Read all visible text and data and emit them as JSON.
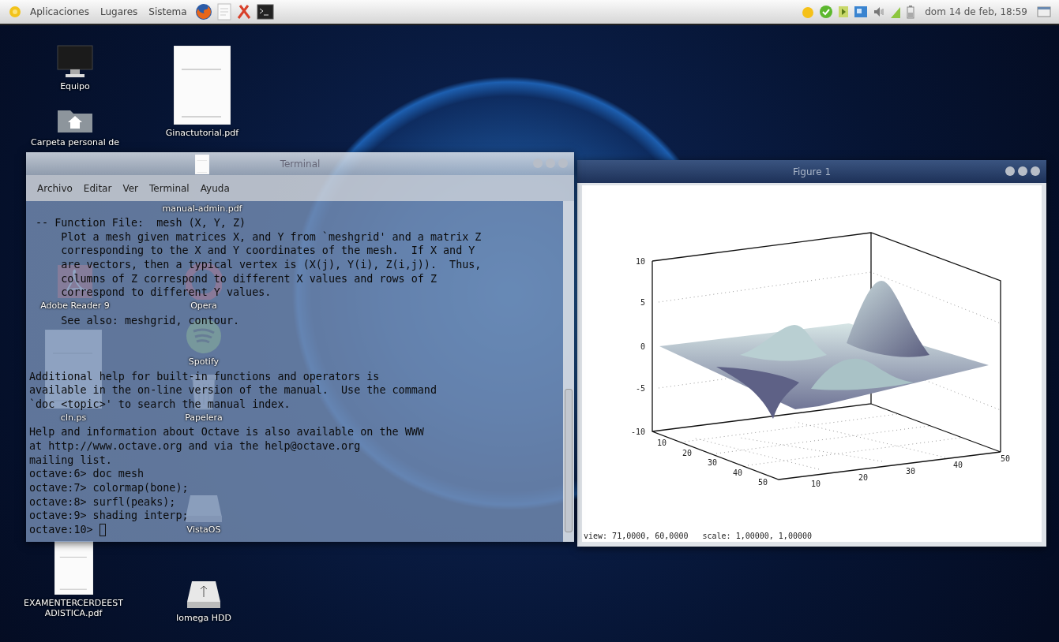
{
  "top_panel": {
    "menus": [
      "Aplicaciones",
      "Lugares",
      "Sistema"
    ],
    "clock": "dom 14 de feb, 18:59"
  },
  "desktop_icons": [
    {
      "label": "Equipo",
      "kind": "monitor"
    },
    {
      "label": "Carpeta personal de",
      "kind": "home"
    },
    {
      "label": "Adobe Reader 9",
      "kind": "reader"
    },
    {
      "label": "cln.ps",
      "kind": "document"
    },
    {
      "label": "EXAMENTERCERDEESTADISTICA.pdf",
      "kind": "document"
    },
    {
      "label": "Ginactutorial.pdf",
      "kind": "document"
    },
    {
      "label": "manual-admin.pdf",
      "kind": "document"
    },
    {
      "label": "Opera",
      "kind": "opera"
    },
    {
      "label": "Spotify",
      "kind": "spotify"
    },
    {
      "label": "Papelera",
      "kind": "trash"
    },
    {
      "label": "VistaOS",
      "kind": "drive"
    },
    {
      "label": "Iomega HDD",
      "kind": "usb"
    }
  ],
  "terminal": {
    "title": "Terminal",
    "menu": [
      "Archivo",
      "Editar",
      "Ver",
      "Terminal",
      "Ayuda"
    ],
    "blocks": [
      [
        " -- Function File:  mesh (X, Y, Z)",
        "     Plot a mesh given matrices X, and Y from `meshgrid' and a matrix Z",
        "     corresponding to the X and Y coordinates of the mesh.  If X and Y",
        "     are vectors, then a typical vertex is (X(j), Y(i), Z(i,j)).  Thus,",
        "     columns of Z correspond to different X values and rows of Z",
        "     correspond to different Y values."
      ],
      [
        "     See also: meshgrid, contour."
      ],
      [
        "Additional help for built-in functions and operators is",
        "available in the on-line version of the manual.  Use the command",
        "`doc <topic>' to search the manual index."
      ],
      [
        "Help and information about Octave is also available on the WWW",
        "at http://www.octave.org and via the help@octave.org",
        "mailing list.",
        "octave:6> doc mesh",
        "octave:7> colormap(bone);",
        "octave:8> surfl(peaks);",
        "octave:9> shading interp;",
        "octave:10> "
      ]
    ]
  },
  "figure": {
    "title": "Figure 1",
    "z_ticks": [
      "10",
      "5",
      "0",
      "-5",
      "-10"
    ],
    "left_ticks": [
      "10",
      "20",
      "30",
      "40",
      "50"
    ],
    "right_ticks": [
      "10",
      "20",
      "30",
      "40",
      "50"
    ],
    "status": "view: 71,0000, 60,0000   scale: 1,00000, 1,00000"
  }
}
